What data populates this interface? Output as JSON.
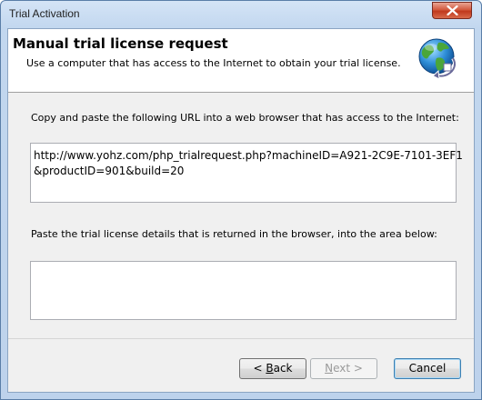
{
  "window": {
    "title": "Trial Activation"
  },
  "header": {
    "title": "Manual trial license request",
    "subtitle": "Use a computer that has access to the Internet to obtain your trial license.",
    "icon": "globe-arrow-icon"
  },
  "url_section": {
    "label": "Copy and paste the following URL into a web browser that has access to the Internet:",
    "url_line1": "http://www.yohz.com/php_trialrequest.php?machineID=A921-2C9E-7101-3EF1",
    "url_line2": "&productID=901&build=20"
  },
  "license_section": {
    "label": "Paste the trial license details that is returned in the browser, into the area below:",
    "value": ""
  },
  "buttons": {
    "back_prefix": "< ",
    "back_mnemonic": "B",
    "back_rest": "ack",
    "next_prefix": "",
    "next_mnemonic": "N",
    "next_rest": "ext >",
    "cancel": "Cancel"
  },
  "colors": {
    "title_bar": "#c2d7ef",
    "close_button": "#c0391d",
    "dialog_bg": "#f0f0f0"
  }
}
